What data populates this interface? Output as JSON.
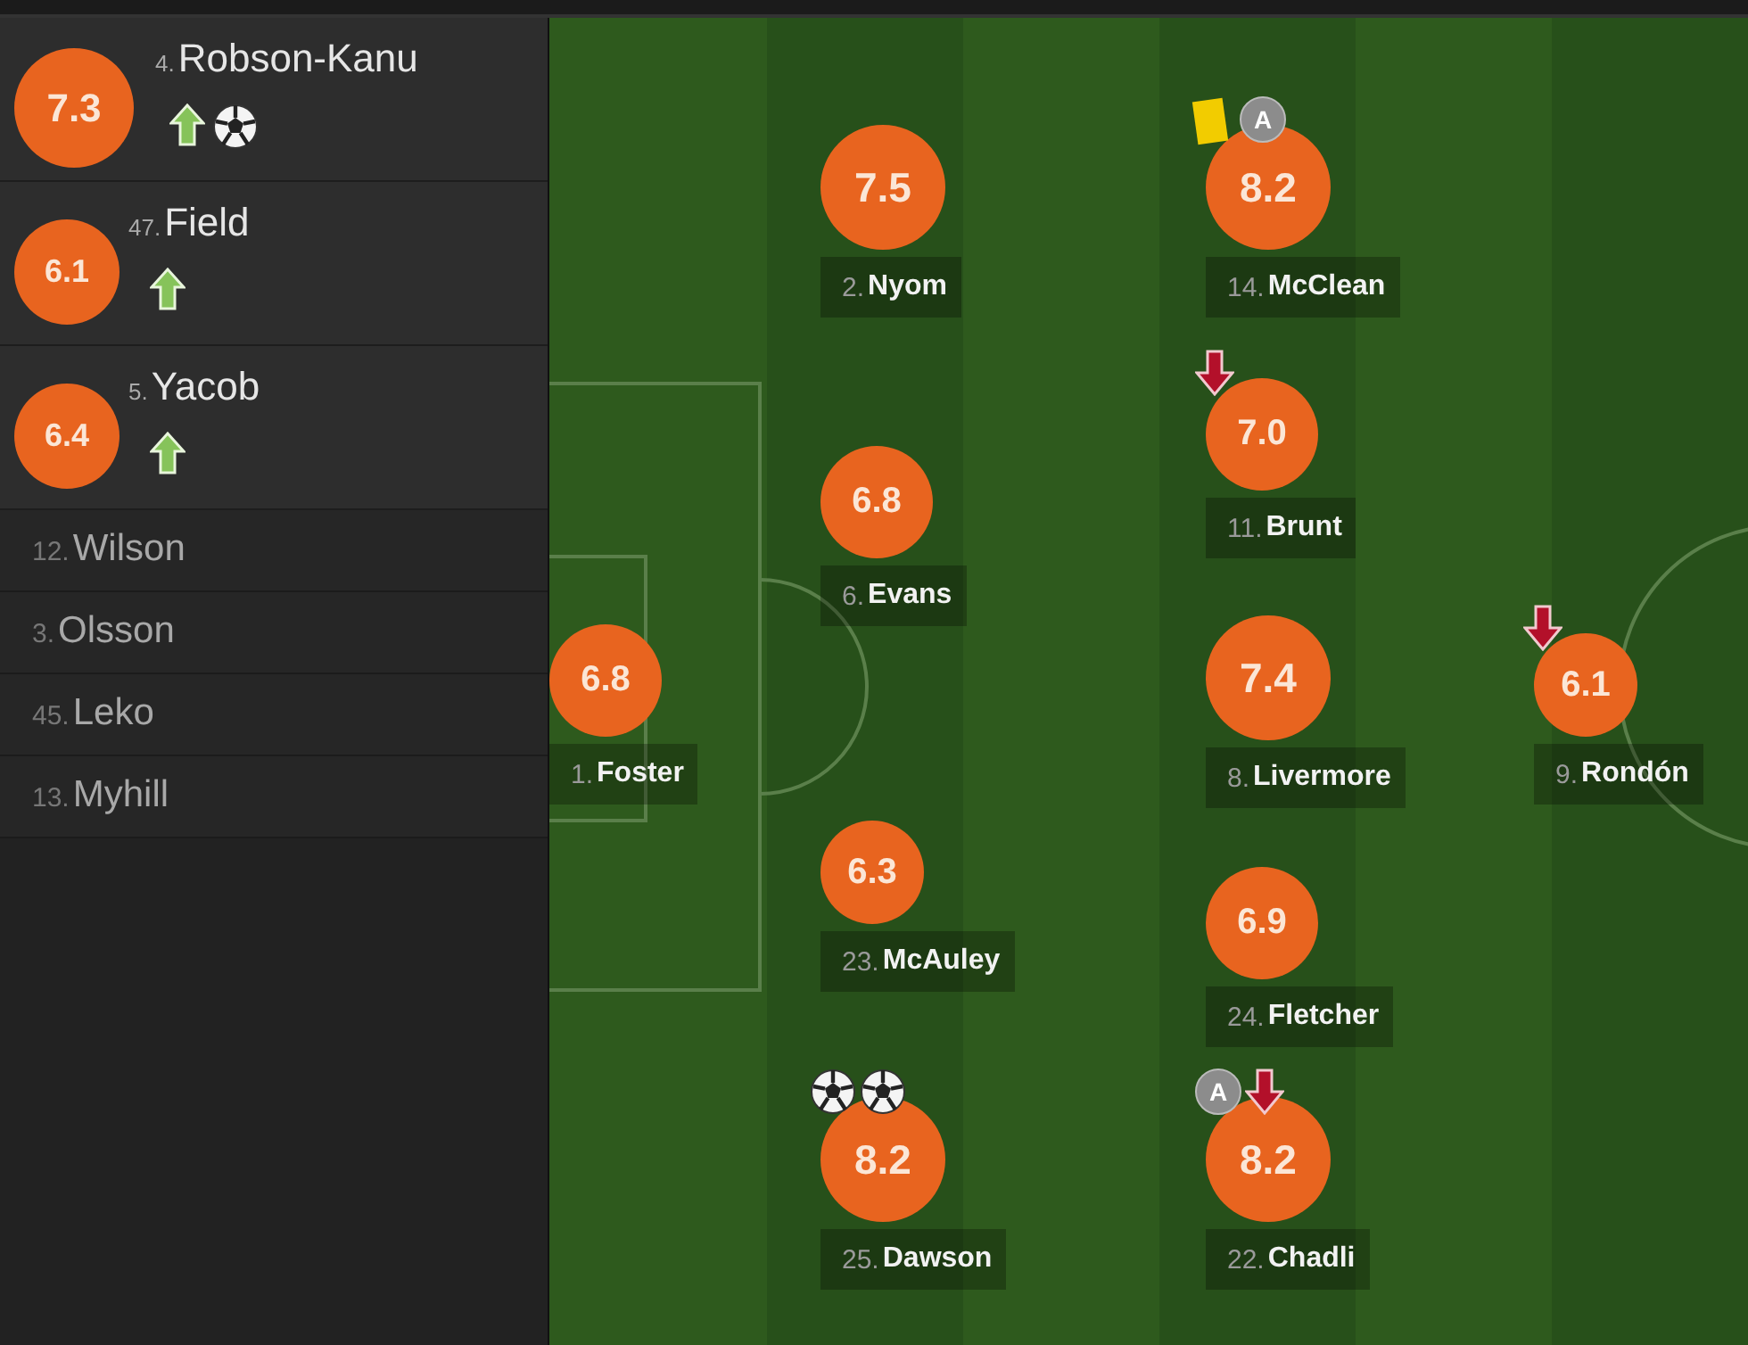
{
  "substitutes": [
    {
      "number": "4.",
      "name": "Robson-Kanu",
      "rating": "7.3",
      "events": [
        {
          "kind": "sub_in"
        },
        {
          "kind": "goal"
        }
      ]
    },
    {
      "number": "47.",
      "name": "Field",
      "rating": "6.1",
      "events": [
        {
          "kind": "sub_in"
        }
      ]
    },
    {
      "number": "5.",
      "name": "Yacob",
      "rating": "6.4",
      "events": [
        {
          "kind": "sub_in"
        }
      ]
    }
  ],
  "unused_substitutes": [
    {
      "number": "12.",
      "name": "Wilson"
    },
    {
      "number": "3.",
      "name": "Olsson"
    },
    {
      "number": "45.",
      "name": "Leko"
    },
    {
      "number": "13.",
      "name": "Myhill"
    }
  ],
  "pitch": {
    "lines": [
      {
        "players": [
          {
            "number": "1.",
            "name": "Foster",
            "rating": "6.8"
          }
        ]
      },
      {
        "players": [
          {
            "number": "2.",
            "name": "Nyom",
            "rating": "7.5"
          },
          {
            "number": "6.",
            "name": "Evans",
            "rating": "6.8"
          },
          {
            "number": "23.",
            "name": "McAuley",
            "rating": "6.3"
          },
          {
            "number": "25.",
            "name": "Dawson",
            "rating": "8.2",
            "events": [
              {
                "kind": "goal"
              },
              {
                "kind": "goal"
              }
            ]
          }
        ]
      },
      {
        "players": [
          {
            "number": "14.",
            "name": "McClean",
            "rating": "8.2",
            "events": [
              {
                "kind": "yellow_card"
              },
              {
                "kind": "assist",
                "label": "A"
              }
            ]
          },
          {
            "number": "11.",
            "name": "Brunt",
            "rating": "7.0",
            "events": [
              {
                "kind": "sub_out"
              }
            ]
          },
          {
            "number": "8.",
            "name": "Livermore",
            "rating": "7.4"
          },
          {
            "number": "24.",
            "name": "Fletcher",
            "rating": "6.9"
          },
          {
            "number": "22.",
            "name": "Chadli",
            "rating": "8.2",
            "events": [
              {
                "kind": "assist",
                "label": "A"
              },
              {
                "kind": "sub_out"
              }
            ]
          }
        ]
      },
      {
        "players": [
          {
            "number": "9.",
            "name": "Rondón",
            "rating": "6.1",
            "events": [
              {
                "kind": "sub_out"
              }
            ]
          }
        ]
      }
    ]
  }
}
